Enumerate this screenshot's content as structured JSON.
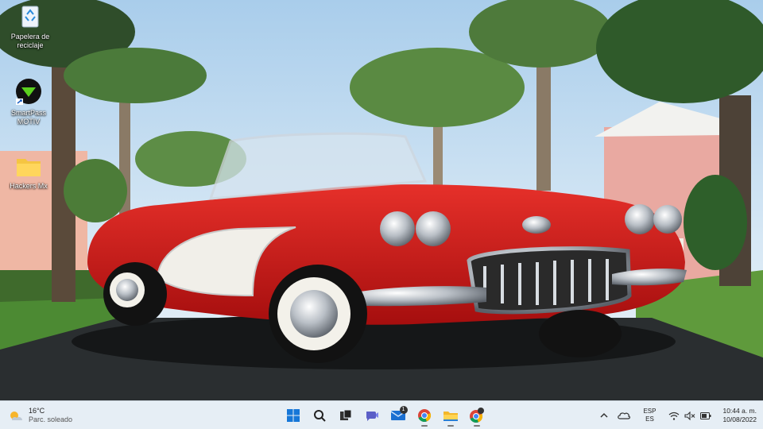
{
  "desktop": {
    "icons": [
      {
        "label": "Papelera de reciclaje"
      },
      {
        "label": "SmartPass MOTIV"
      },
      {
        "label": "Hackers Mx"
      }
    ]
  },
  "taskbar": {
    "weather": {
      "temp": "16°C",
      "condition": "Parc. soleado"
    },
    "apps": [
      {
        "icon": "windows-start-icon"
      },
      {
        "icon": "search-icon"
      },
      {
        "icon": "task-view-icon"
      },
      {
        "icon": "video-chat-icon"
      },
      {
        "icon": "mail-icon",
        "badge": "1"
      },
      {
        "icon": "chrome-icon"
      },
      {
        "icon": "file-explorer-icon"
      },
      {
        "icon": "chrome-profile-icon"
      }
    ],
    "tray": {
      "language_top": "ESP",
      "language_bottom": "ES",
      "time": "10:44 a. m.",
      "date": "10/08/2022"
    }
  },
  "colors": {
    "taskbar_bg": "#e6eef5",
    "car_red": "#d21a1a",
    "sky": "#bcd8ef"
  }
}
